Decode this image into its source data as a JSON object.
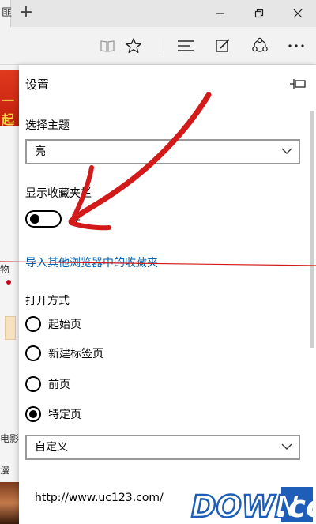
{
  "titlebar": {
    "tab_fragment": "匪",
    "new_tab": "+"
  },
  "background_page": {
    "banner_text": "一起",
    "fragments": [
      "物",
      "电影",
      "漫"
    ]
  },
  "settings": {
    "title": "设置",
    "theme_label": "选择主题",
    "theme_value": "亮",
    "favorites_bar_label": "显示收藏夹栏",
    "favorites_bar_state": "关",
    "import_link": "导入其他浏览器中的收藏夹",
    "open_with_label": "打开方式",
    "open_options": [
      {
        "label": "起始页",
        "checked": false
      },
      {
        "label": "新建标签页",
        "checked": false
      },
      {
        "label": "前页",
        "checked": false
      },
      {
        "label": "特定页",
        "checked": true
      }
    ],
    "specific_page_value": "自定义",
    "url": "http://www.uc123.com/"
  },
  "watermark": {
    "text": "DOWN.cc"
  },
  "colors": {
    "accent_link": "#0063b1",
    "annotation_red": "#d21a1a",
    "watermark_blue": "#1e5eb8"
  }
}
